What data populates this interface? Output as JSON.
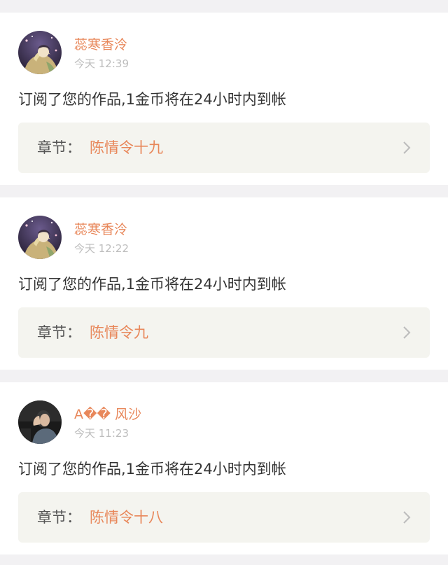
{
  "notifications": [
    {
      "username": "蕊寒香泠",
      "time": "今天 12:39",
      "message": "订阅了您的作品,1金币将在24小时内到帐",
      "chapter_prefix": "章节：",
      "chapter_title": "陈情令十九",
      "avatar_icon": "anime-girl-avatar-icon"
    },
    {
      "username": "蕊寒香泠",
      "time": "今天 12:22",
      "message": "订阅了您的作品,1金币将在24小时内到帐",
      "chapter_prefix": "章节：",
      "chapter_title": "陈情令九",
      "avatar_icon": "anime-girl-avatar-icon"
    },
    {
      "username": "A�� 风沙",
      "time": "今天 11:23",
      "message": "订阅了您的作品,1金币将在24小时内到帐",
      "chapter_prefix": "章节：",
      "chapter_title": "陈情令十八",
      "avatar_icon": "person-photo-avatar-icon"
    }
  ],
  "colors": {
    "accent": "#e8875a",
    "page_bg": "#f2f1f3",
    "card_bg": "#ffffff",
    "chapter_bg": "#f4f4ef",
    "muted_text": "#bdbdbd",
    "body_text": "#333333"
  }
}
